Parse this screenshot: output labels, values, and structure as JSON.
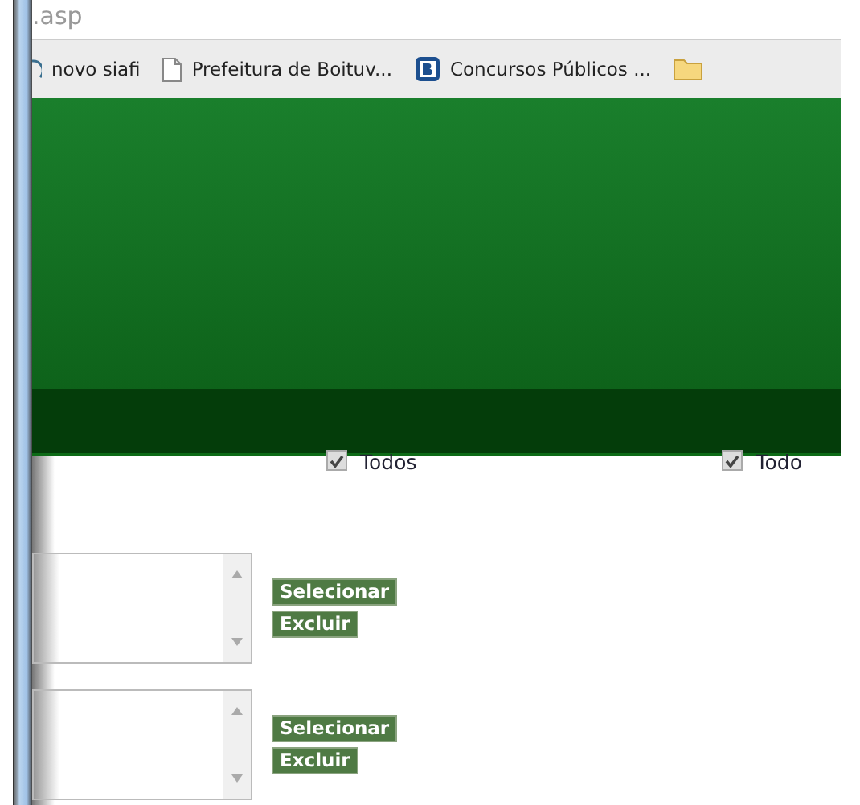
{
  "address_bar": {
    "url": ".asp"
  },
  "bookmarks": [
    {
      "label": "novo siafi"
    },
    {
      "label": "Prefeitura de Boituv..."
    },
    {
      "label": "Concursos Públicos ..."
    }
  ],
  "filters": [
    {
      "label": "Todos",
      "checked": true
    },
    {
      "label": "Todo",
      "checked": true
    }
  ],
  "lists": [
    {
      "buttons": [
        "Selecionar",
        "Excluir"
      ]
    },
    {
      "buttons": [
        "Selecionar",
        "Excluir"
      ]
    }
  ]
}
